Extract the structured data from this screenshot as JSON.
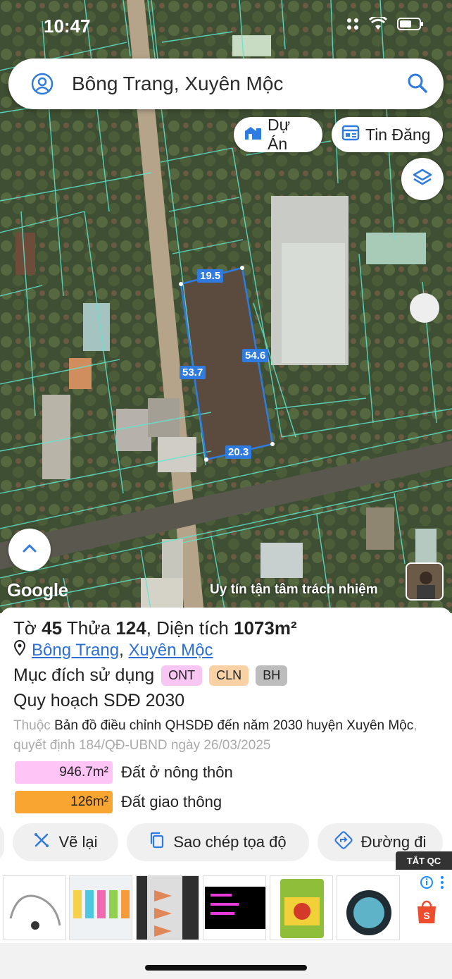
{
  "status": {
    "time": "10:47"
  },
  "search": {
    "query": "Bông Trang, Xuyên Mộc"
  },
  "chips": {
    "du_an": "Dự Án",
    "tin_dang": "Tin Đăng"
  },
  "map": {
    "google_label": "Google",
    "slogan": "Uy tín tận tâm trách nhiệm",
    "dimensions": {
      "top": "19.5",
      "right": "54.6",
      "left": "53.7",
      "bottom": "20.3"
    },
    "boundary_color": "#2f7be0"
  },
  "parcel": {
    "to_label": "Tờ",
    "to_value": "45",
    "thua_label": "Thửa",
    "thua_value": "124",
    "dien_tich_label": "Diện tích",
    "area": "1073m²",
    "location": {
      "commune": "Bông Trang",
      "district": "Xuyên Mộc",
      "separator": ","
    },
    "purpose_label": "Mục đích sử dụng",
    "badges": [
      {
        "code": "ONT",
        "color": "#f7c6f3"
      },
      {
        "code": "CLN",
        "color": "#f8d2a4"
      },
      {
        "code": "BH",
        "color": "#bdbdbd"
      }
    ],
    "plan_title": "Quy hoạch SDĐ 2030",
    "desc_prefix": "Thuộc",
    "desc_main": "Bản đồ điều chỉnh QHSDĐ đến năm 2030 huyện Xuyên Mộc",
    "desc_suffix": ", quyết định 184/QĐ-UBND ngày 26/03/2025",
    "land_uses": [
      {
        "area": "946.7m²",
        "label": "Đất ở nông thôn",
        "color": "#ffc4f6"
      },
      {
        "area": "126m²",
        "label": "Đất giao thông",
        "color": "#f8a531"
      }
    ]
  },
  "actions": {
    "redraw": "Vẽ lại",
    "copy": "Sao chép tọa độ",
    "directions": "Đường đi"
  },
  "ad": {
    "close_label": "TẮT QC"
  }
}
